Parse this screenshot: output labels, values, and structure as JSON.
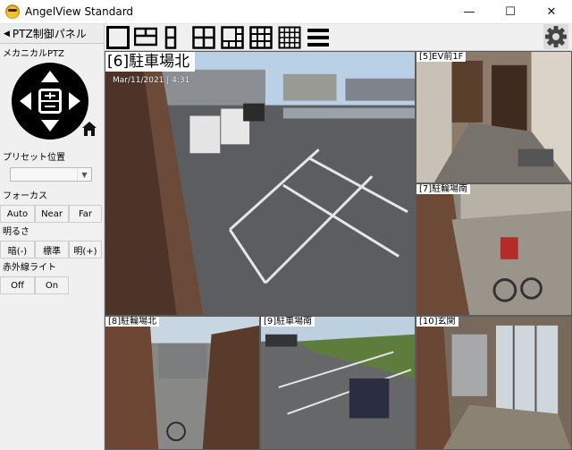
{
  "window": {
    "title": "AngelView Standard",
    "controls": {
      "minimize": "—",
      "maximize": "☐",
      "close": "✕"
    }
  },
  "left_panel": {
    "header": "PTZ制御パネル",
    "header_arrow": "◀",
    "mechanical_ptz_label": "メカニカルPTZ",
    "preset_label": "プリセット位置",
    "preset_value": "",
    "focus_label": "フォーカス",
    "focus_buttons": [
      "Auto",
      "Near",
      "Far"
    ],
    "brightness_label": "明るさ",
    "brightness_buttons": [
      "暗(-)",
      "標準",
      "明(+)"
    ],
    "ir_label": "赤外線ライト",
    "ir_buttons": [
      "Off",
      "On"
    ]
  },
  "cameras": [
    {
      "label": "[6]駐車場北",
      "timestamp": "Mar/11/2021 | 4:31"
    },
    {
      "label": "[5]EV前1F"
    },
    {
      "label": "[7]駐輪場南"
    },
    {
      "label": "[8]駐輪場北"
    },
    {
      "label": "[9]駐車場南"
    },
    {
      "label": "[10]玄関"
    }
  ],
  "colors": {
    "panel_bg": "#f0f0f0",
    "titlebar_bg": "#ffffff",
    "grid_bg": "#1d1d1d"
  }
}
